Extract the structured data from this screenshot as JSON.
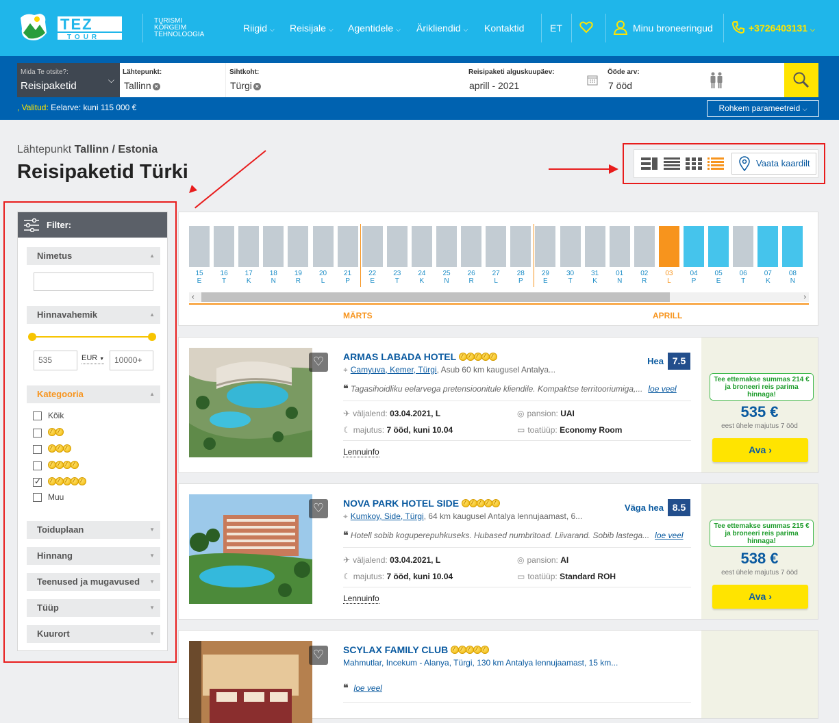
{
  "header": {
    "logo_text": "TEZ TOUR",
    "slogan": [
      "TURISMI",
      "KÕRGEIM",
      "TEHNOLOOGIA"
    ],
    "nav": [
      "Riigid",
      "Reisijale",
      "Agentidele",
      "Ärikliendid",
      "Kontaktid"
    ],
    "lang": "ET",
    "bookings": "Minu broneeringud",
    "phone": "+3726403131"
  },
  "search": {
    "what_label": "Mida Te otsite?:",
    "what_value": "Reisipaketid",
    "from_label": "Lähtepunkt:",
    "from_value": "Tallinn",
    "to_label": "Sihtkoht:",
    "to_value": "Türgi",
    "date_label": "Reisipaketi alguskuupäev:",
    "date_value": "aprill - 2021",
    "nights_label": "Ööde arv:",
    "nights_value": "7 ööd",
    "selected_label": ", Valitud:",
    "selected_value": "Eelarve: kuni 115 000 €",
    "more_params": "Rohkem parameetreid"
  },
  "page": {
    "crumb_prefix": "Lähtepunkt",
    "crumb_city": "Tallinn / Estonia",
    "title": "Reisipaketid Türki",
    "map_button": "Vaata kaardilt"
  },
  "filter": {
    "title": "Filter:",
    "sec_name": "Nimetus",
    "sec_price": "Hinnavahemik",
    "price_min": "535",
    "currency": "EUR",
    "price_max": "10000+",
    "sec_category": "Kategooria",
    "cat_all": "Kõik",
    "cat_other": "Muu",
    "sec_meals": "Toiduplaan",
    "sec_rating": "Hinnang",
    "sec_services": "Teenused ja mugavused",
    "sec_type": "Tüüp",
    "sec_resort": "Kuurort"
  },
  "calendar": {
    "days": [
      {
        "n": "15",
        "d": "E"
      },
      {
        "n": "16",
        "d": "T"
      },
      {
        "n": "17",
        "d": "K"
      },
      {
        "n": "18",
        "d": "N"
      },
      {
        "n": "19",
        "d": "R"
      },
      {
        "n": "20",
        "d": "L"
      },
      {
        "n": "21",
        "d": "P"
      },
      {
        "n": "22",
        "d": "E"
      },
      {
        "n": "23",
        "d": "T"
      },
      {
        "n": "24",
        "d": "K"
      },
      {
        "n": "25",
        "d": "N"
      },
      {
        "n": "26",
        "d": "R"
      },
      {
        "n": "27",
        "d": "L"
      },
      {
        "n": "28",
        "d": "P"
      },
      {
        "n": "29",
        "d": "E"
      },
      {
        "n": "30",
        "d": "T"
      },
      {
        "n": "31",
        "d": "K"
      },
      {
        "n": "01",
        "d": "N"
      },
      {
        "n": "02",
        "d": "R"
      },
      {
        "n": "03",
        "d": "L"
      },
      {
        "n": "04",
        "d": "P"
      },
      {
        "n": "05",
        "d": "E"
      },
      {
        "n": "06",
        "d": "T"
      },
      {
        "n": "07",
        "d": "K"
      },
      {
        "n": "08",
        "d": "N"
      }
    ],
    "month1": "MÄRTS",
    "month2": "APRILL"
  },
  "hotels": [
    {
      "name": "ARMAS LABADA HOTEL",
      "stars": 5,
      "rating_word": "Hea",
      "rating": "7.5",
      "loc_link": "Camyuva, Kemer, Türgi",
      "loc_rest": ", Asub 60 km kaugusel Antalya...",
      "desc": "Tagasihoidliku eelarvega pretensioonitule kliendile. Kompaktse territooriumiga,...",
      "more": "loe veel",
      "dep_label": "väljalend:",
      "dep": "03.04.2021, L",
      "meal_label": "pansion:",
      "meal": "UAI",
      "stay_label": "majutus:",
      "stay": "7 ööd, kuni 10.04",
      "room_label": "toatüüp:",
      "room": "Economy Room",
      "flight": "Lennuinfo",
      "promo": "Tee ettemakse summas 214 € ja broneeri reis parima hinnaga!",
      "price": "535 €",
      "price_note": "eest ühele majutus 7 ööd",
      "btn": "Ava ›"
    },
    {
      "name": "NOVA PARK HOTEL SIDE",
      "stars": 5,
      "rating_word": "Väga hea",
      "rating": "8.5",
      "loc_link": "Kumkoy, Side, Türgi",
      "loc_rest": ", 64 km kaugusel Antalya lennujaamast, 6...",
      "desc": "Hotell sobib koguperepuhkuseks. Hubased numbritoad. Liivarand. Sobib lastega...",
      "more": "loe veel",
      "dep_label": "väljalend:",
      "dep": "03.04.2021, L",
      "meal_label": "pansion:",
      "meal": "AI",
      "stay_label": "majutus:",
      "stay": "7 ööd, kuni 10.04",
      "room_label": "toatüüp:",
      "room": "Standard ROH",
      "flight": "Lennuinfo",
      "promo": "Tee ettemakse summas 215 € ja broneeri reis parima hinnaga!",
      "price": "538 €",
      "price_note": "eest ühele majutus 7 ööd",
      "btn": "Ava ›"
    },
    {
      "name": "SCYLAX FAMILY CLUB",
      "stars": 5,
      "loc": "Mahmutlar, Incekum - Alanya, Türgi, 130 km Antalya lennujaamast, 15 km...",
      "more": "loe veel"
    }
  ],
  "colors": {
    "header": "#1fb6ea",
    "searchbar": "#0062b0",
    "accent": "#f7941d",
    "yellow": "#ffe400",
    "link": "#0a5aa0"
  }
}
